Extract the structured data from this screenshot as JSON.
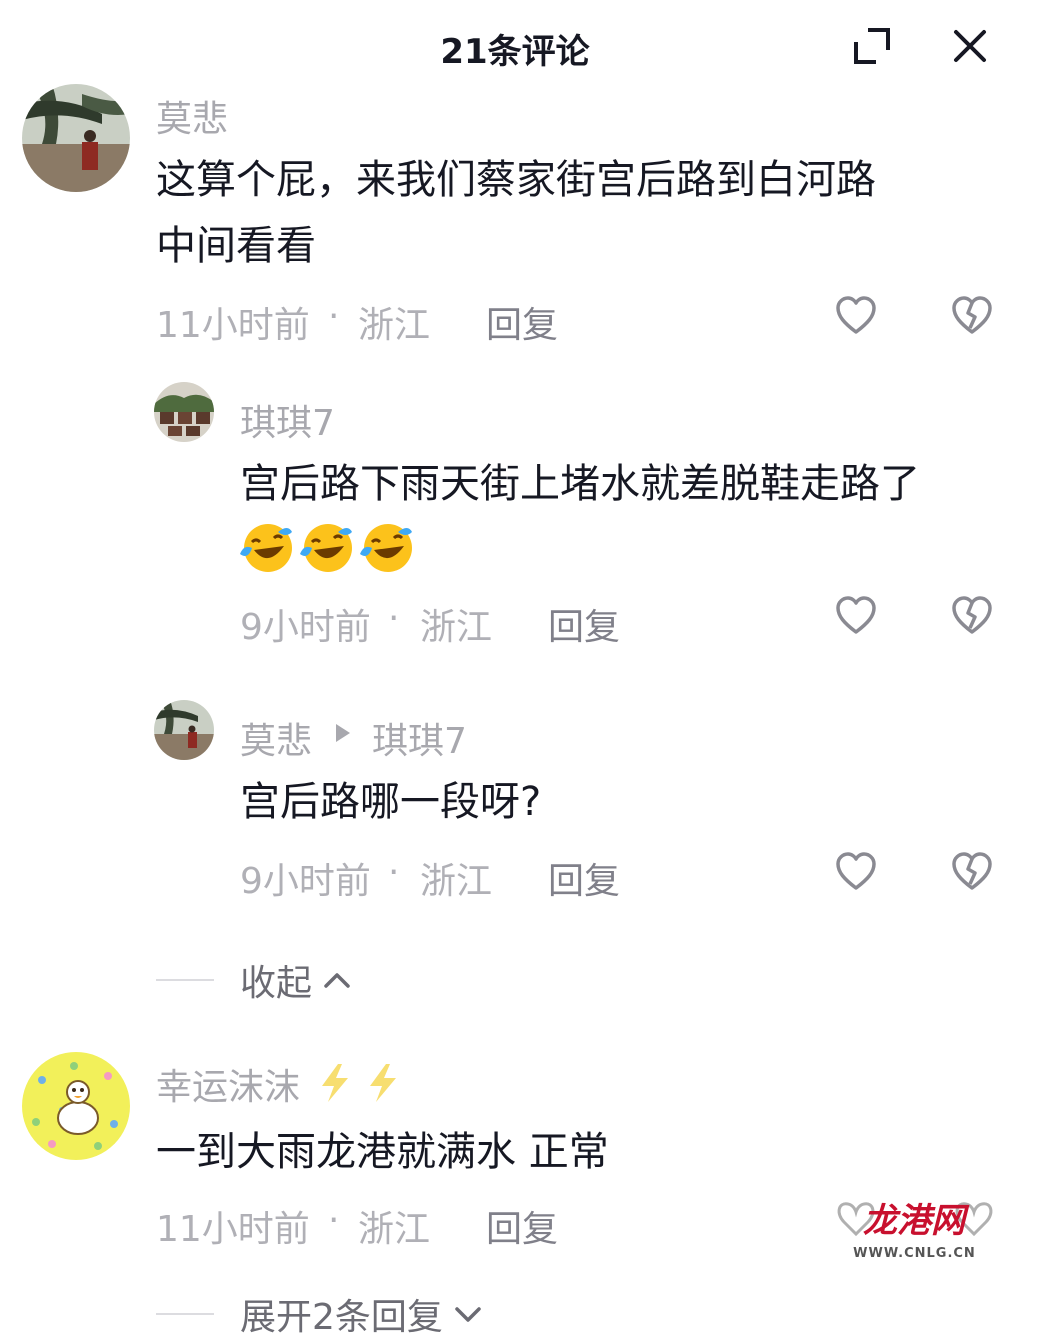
{
  "header": {
    "title": "21条评论"
  },
  "comments": [
    {
      "user": "莫悲",
      "text_line1": "这算个屁，来我们蔡家街宫后路到白河路",
      "text_line2": "中间看看",
      "time": "11小时前",
      "dot": "·",
      "location": "浙江",
      "reply_label": "回复"
    },
    {
      "user": "幸运沫沫",
      "text": "一到大雨龙港就满水 正常",
      "time": "11小时前",
      "dot": "·",
      "location": "浙江",
      "reply_label": "回复",
      "expand_label": "展开2条回复"
    }
  ],
  "replies": [
    {
      "user": "琪琪7",
      "text": "宫后路下雨天街上堵水就差脱鞋走路了",
      "emoji": [
        "face-with-tears-of-joy",
        "face-with-tears-of-joy",
        "face-with-tears-of-joy"
      ],
      "time": "9小时前",
      "dot": "·",
      "location": "浙江",
      "reply_label": "回复"
    },
    {
      "user": "莫悲",
      "reply_to": "琪琪7",
      "text": "宫后路哪一段呀?",
      "time": "9小时前",
      "dot": "·",
      "location": "浙江",
      "reply_label": "回复"
    }
  ],
  "collapse_label": "收起",
  "watermark": {
    "logo_text": "龙港网",
    "url": "WWW.CNLG.CN"
  },
  "colors": {
    "primary_text": "#161823",
    "secondary_text": "#a8a8ae",
    "bolt": "#f4d35a"
  }
}
